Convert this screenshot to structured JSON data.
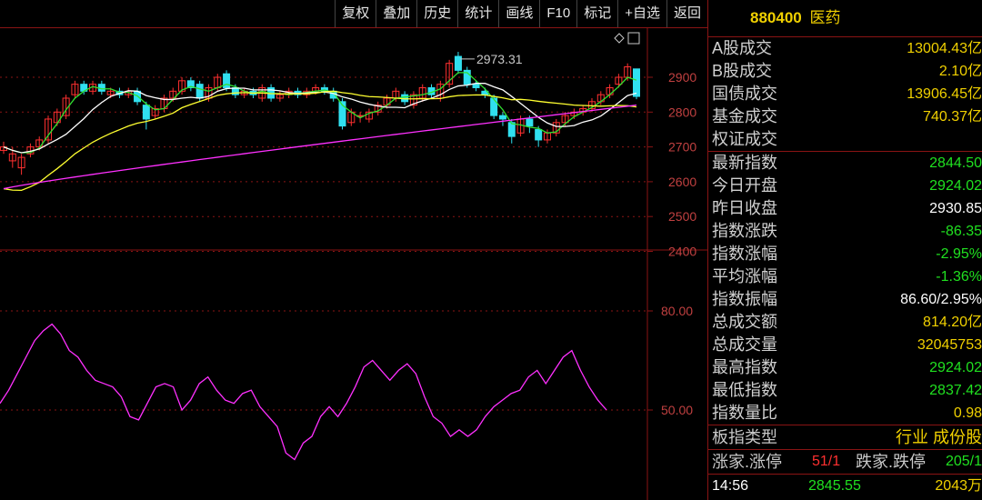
{
  "toolbar": {
    "buttons": [
      "复权",
      "叠加",
      "历史",
      "统计",
      "画线",
      "F10",
      "标记",
      "+自选",
      "返回"
    ]
  },
  "chart": {
    "price_axis": [
      "2900",
      "2800",
      "2700",
      "2600",
      "2500",
      "2400"
    ],
    "osc_axis": [
      "80.00",
      "50.00"
    ],
    "max_marker": "2973.31",
    "colors": {
      "up": "#ff3030",
      "down": "#30e0f0",
      "ma5": "#ffffff",
      "ma10": "#ffff30",
      "ma20": "#ff30ff",
      "ma_short": "#30e030",
      "osc": "#ff30ff",
      "grid": "#8a1414"
    }
  },
  "quote": {
    "code": "880400",
    "name": "医药",
    "rows_top": [
      {
        "label": "A股成交",
        "value": "13004.43亿",
        "color": "yellow"
      },
      {
        "label": "B股成交",
        "value": "2.10亿",
        "color": "yellow"
      },
      {
        "label": "国债成交",
        "value": "13906.45亿",
        "color": "yellow"
      },
      {
        "label": "基金成交",
        "value": "740.37亿",
        "color": "yellow"
      },
      {
        "label": "权证成交",
        "value": "",
        "color": "yellow"
      }
    ],
    "rows_mid": [
      {
        "label": "最新指数",
        "value": "2844.50",
        "color": "green"
      },
      {
        "label": "今日开盘",
        "value": "2924.02",
        "color": "green"
      },
      {
        "label": "昨日收盘",
        "value": "2930.85",
        "color": "white"
      },
      {
        "label": "指数涨跌",
        "value": "-86.35",
        "color": "green"
      },
      {
        "label": "指数涨幅",
        "value": "-2.95%",
        "color": "green"
      },
      {
        "label": "平均涨幅",
        "value": "-1.36%",
        "color": "green"
      },
      {
        "label": "指数振幅",
        "value": "86.60/2.95%",
        "color": "white"
      },
      {
        "label": "总成交额",
        "value": "814.20亿",
        "color": "yellow"
      },
      {
        "label": "总成交量",
        "value": "32045753",
        "color": "yellow"
      },
      {
        "label": "最高指数",
        "value": "2924.02",
        "color": "green"
      },
      {
        "label": "最低指数",
        "value": "2837.42",
        "color": "green"
      },
      {
        "label": "指数量比",
        "value": "0.98",
        "color": "yellow"
      }
    ],
    "board_type_label": "板指类型",
    "board_type_value": "行业 成份股",
    "rise_label": "涨家.涨停",
    "rise_value": "51/1",
    "fall_label": "跌家.跌停",
    "fall_value": "205/1",
    "time": "14:56",
    "last_price": "2845.55",
    "last_volume": "2043万"
  }
}
